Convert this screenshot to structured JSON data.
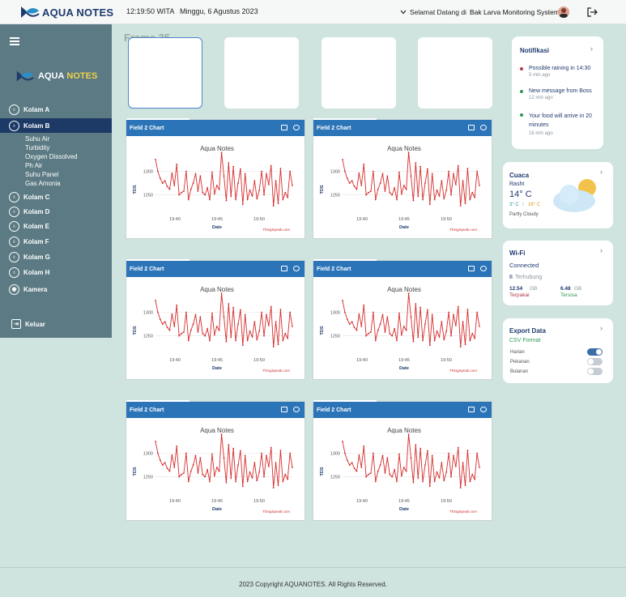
{
  "header": {
    "brand": "AQUA NOTES",
    "clock": "12:19:50 WITA",
    "date": "Minggu, 6 Agustus 2023",
    "welcome_prefix": "Selamat Datang di",
    "welcome_name": "Bak Larva Monitoring System"
  },
  "sidebar": {
    "brand_a": "AQUA",
    "brand_b": "NOTES",
    "items": [
      {
        "label": "Kolam A"
      },
      {
        "label": "Kolam B"
      },
      {
        "label": "Kolam C"
      },
      {
        "label": "Kolam  D"
      },
      {
        "label": "Kolam E"
      },
      {
        "label": "Kolam F"
      },
      {
        "label": "Kolam G"
      },
      {
        "label": "Kolam H"
      },
      {
        "label": "Kamera"
      }
    ],
    "subitems": [
      "Suhu Air",
      "Turbidity",
      "Oxygen Dissolved",
      "Ph Air",
      "Suhu Panel",
      "Gas Amonia"
    ],
    "logout": "Keluar"
  },
  "frame_label": "Frame 35",
  "charts": {
    "header_label": "Field 2 Chart",
    "title": "Aqua Notes",
    "xlabel": "Date",
    "ylabel": "TDS",
    "credit": "ThingSpeak.com",
    "yticks": [
      "1300",
      "1250"
    ],
    "xticks": [
      "19:40",
      "19:45",
      "19:50"
    ]
  },
  "chart_data": {
    "type": "line",
    "title": "Aqua Notes",
    "xlabel": "Date",
    "ylabel": "TDS",
    "ylim": [
      1210,
      1330
    ],
    "x_range": [
      "19:35",
      "19:53"
    ],
    "series": [
      {
        "values": [
          1325,
          1300,
          1285,
          1275,
          1280,
          1268,
          1262,
          1296,
          1270,
          1315,
          1250,
          1255,
          1258,
          1300,
          1240,
          1262,
          1275,
          1295,
          1258,
          1290,
          1255,
          1250,
          1265,
          1240,
          1298,
          1252,
          1270,
          1262,
          1340,
          1290,
          1238,
          1318,
          1247,
          1310,
          1240,
          1275,
          1305,
          1230,
          1295,
          1240,
          1260,
          1248,
          1280,
          1242,
          1260,
          1300,
          1250,
          1295,
          1272,
          1312,
          1227,
          1280,
          1232,
          1306,
          1240,
          1255,
          1245,
          1300,
          1270
        ]
      }
    ]
  },
  "notifications": {
    "title": "Notifikasi",
    "items": [
      {
        "text": "Possible raining in 14:30",
        "time": "5 min ago",
        "color": "#b03a48"
      },
      {
        "text": "New message from Boss",
        "time": "12 min ago",
        "color": "#2e9a52"
      },
      {
        "text": "Your food will arrive in 20 minutes",
        "time": "16 min ago",
        "color": "#2e9a52"
      }
    ]
  },
  "weather": {
    "title": "Cuaca",
    "city": "Rasht",
    "temp": "14° C",
    "low": "3° C",
    "sep": "/",
    "high": "16° C",
    "desc": "Partly Cloudy"
  },
  "wifi": {
    "title": "Wi-Fi",
    "status": "Connected",
    "count": "8",
    "count_label": "Terhubung",
    "used_value": "12.54",
    "used_unit": "GB",
    "used_label": "Terpakai",
    "left_value": "6.48",
    "left_unit": "GB",
    "left_label": "Tersisa"
  },
  "export": {
    "title": "Export Data",
    "format": "CSV Format",
    "options": [
      {
        "label": "Harian",
        "on": true
      },
      {
        "label": "Pekanan",
        "on": false
      },
      {
        "label": "Bulanan",
        "on": false
      }
    ]
  },
  "footer": {
    "copyright": "2023 Copyright AQUANOTES. All Rights Reserved."
  }
}
